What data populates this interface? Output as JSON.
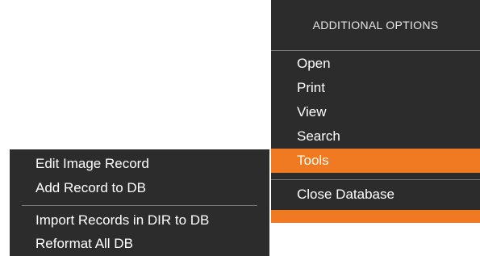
{
  "options_menu": {
    "header": "ADDITIONAL OPTIONS",
    "items": [
      {
        "label": "Open",
        "active": false
      },
      {
        "label": "Print",
        "active": false
      },
      {
        "label": "View",
        "active": false
      },
      {
        "label": "Search",
        "active": false
      },
      {
        "label": "Tools",
        "active": true
      }
    ],
    "close_label": "Close Database"
  },
  "tools_submenu": {
    "items_group1": [
      "Edit Image Record",
      "Add Record to DB"
    ],
    "items_group2": [
      "Import Records in DIR to DB",
      "Reformat All DB"
    ]
  },
  "colors": {
    "menu_background": "#2c2c2c",
    "accent": "#f07a22",
    "divider": "#7a7a7a",
    "text": "#ffffff"
  }
}
